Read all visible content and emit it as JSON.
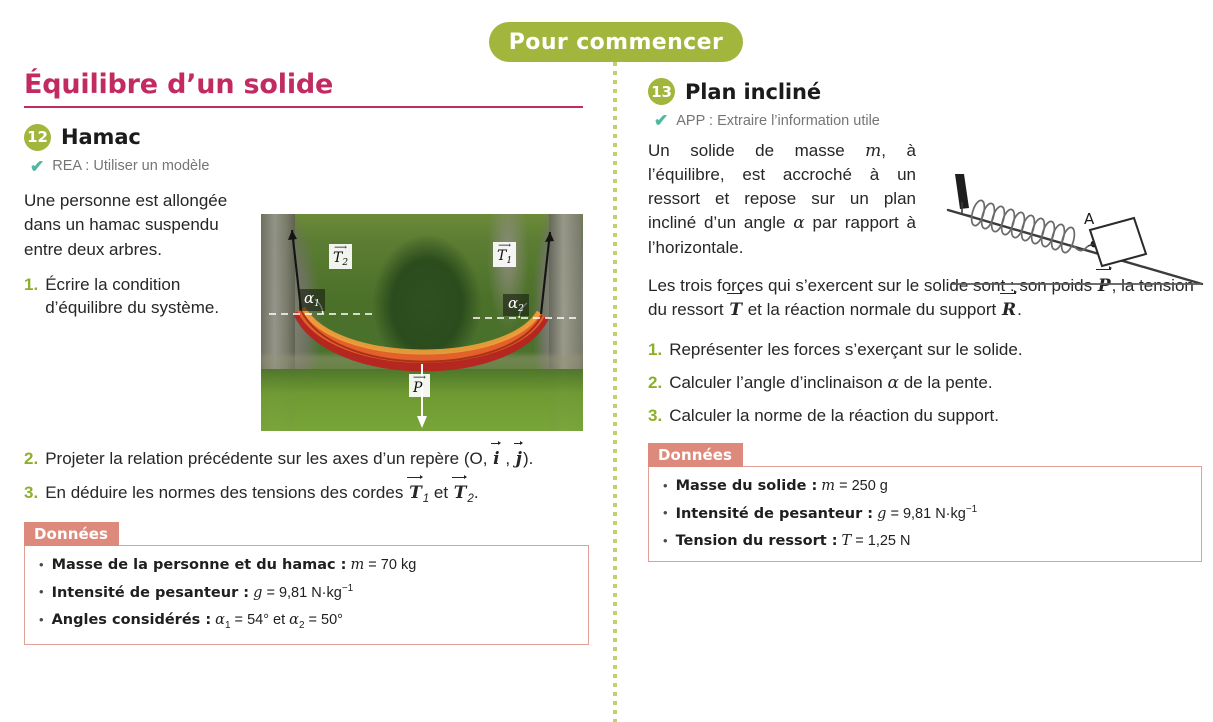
{
  "banner": {
    "label": "Pour commencer",
    "color": "#a2b53c"
  },
  "left": {
    "section_title": "Équilibre d’un solide",
    "section_title_color": "#c22a62",
    "exercise": {
      "number": "12",
      "title": "Hamac",
      "competence": "REA : Utiliser un modèle",
      "check_icon": "check-icon",
      "intro": "Une personne est allongée dans un hamac suspendu entre deux arbres.",
      "questions": [
        {
          "n": "1.",
          "text": "Écrire la condition d’équilibre du système."
        },
        {
          "n": "2.",
          "text": "Projeter la relation précédente sur les axes d’un repère (O, i⃗ , j⃗ )."
        },
        {
          "n": "3.",
          "text": "En déduire les normes des tensions des cordes T⃗₁ et T⃗₂."
        }
      ]
    },
    "photo": {
      "alt": "Photographie d’un hamac suspendu entre deux arbres",
      "labels": [
        "T2",
        "T1",
        "α1",
        "α2",
        "P"
      ]
    },
    "donnees": {
      "title": "Données",
      "items": [
        {
          "label": "Masse de la personne et du hamac :",
          "value": "m = 70 kg"
        },
        {
          "label": "Intensité de pesanteur :",
          "value": "g = 9,81 N·kg⁻¹"
        },
        {
          "label": "Angles considérés :",
          "value": "α1 = 54° et α2 = 50°"
        }
      ]
    }
  },
  "right": {
    "exercise": {
      "number": "13",
      "title": "Plan incliné",
      "competence": "APP : Extraire l’information utile",
      "check_icon": "check-icon",
      "paragraph1": "Un solide de masse m, à l’équilibre, est accroché à un ressort et repose sur un plan incliné d’un angle α par rapport à l’horizontale.",
      "paragraph2": "Les trois forces qui s’exercent sur le solide sont : son poids P⃗, la tension du ressort T⃗ et la réaction normale du support R⃗.",
      "questions": [
        {
          "n": "1.",
          "text": "Représenter les forces s’exerçant sur le solide."
        },
        {
          "n": "2.",
          "text": "Calculer l’angle d’inclinaison α de la pente."
        },
        {
          "n": "3.",
          "text": "Calculer la norme de la réaction du support."
        }
      ]
    },
    "figure": {
      "alt": "Schéma d’un solide sur un plan incliné relié à un ressort",
      "point_label": "A"
    },
    "donnees": {
      "title": "Données",
      "items": [
        {
          "label": "Masse du solide :",
          "value": "m = 250 g"
        },
        {
          "label": "Intensité de pesanteur :",
          "value": "g = 9,81 N·kg⁻¹"
        },
        {
          "label": "Tension du ressort :",
          "value": "T = 1,25 N"
        }
      ]
    }
  },
  "text_fragments": {
    "p1_a": "Un solide de masse ",
    "p1_m": "m",
    "p1_b": ", à l’équilibre, est accroché à un ressort et repose sur un plan incliné d’un angle ",
    "p1_alpha": "α",
    "p1_c": " par rapport à l’horizontale.",
    "p2_a": "Les trois forces qui s’exercent sur le solide sont : son poids ",
    "p2_P": "P",
    "p2_b": ", la tension du ressort ",
    "p2_T": "T",
    "p2_c": " et la réaction normale du support ",
    "p2_R": "R",
    "p2_d": ".",
    "q2_left_a": "Projeter la relation précédente sur les axes d’un repère (O, ",
    "q2_left_i": "i",
    "q2_left_comma": " , ",
    "q2_left_j": "j",
    "q2_left_b": ").",
    "q3_left_a": "En déduire les normes des tensions des cordes ",
    "q3_left_T": "T",
    "q3_left_sub1": "1",
    "q3_left_et": " et ",
    "q3_left_T2": "T",
    "q3_left_sub2": "2",
    "q3_left_end": ".",
    "q2_right_a": "Calculer l’angle d’inclinaison ",
    "q2_right_alpha": "α",
    "q2_right_b": " de la pente.",
    "unit_nkg": "N·kg",
    "sup_minus1": "−1",
    "mass_left": "70 kg",
    "mass_right": "250 g",
    "g_value": "9,81 ",
    "T_value": "1,25 N",
    "alpha1_val": "54°",
    "alpha2_val": "50°",
    "et": " et "
  },
  "colors": {
    "green": "#a2b53c",
    "crimson": "#c22a62",
    "teal_check": "#52b79f",
    "salmon": "#dd8a7d",
    "question_num": "#8fae2e"
  }
}
